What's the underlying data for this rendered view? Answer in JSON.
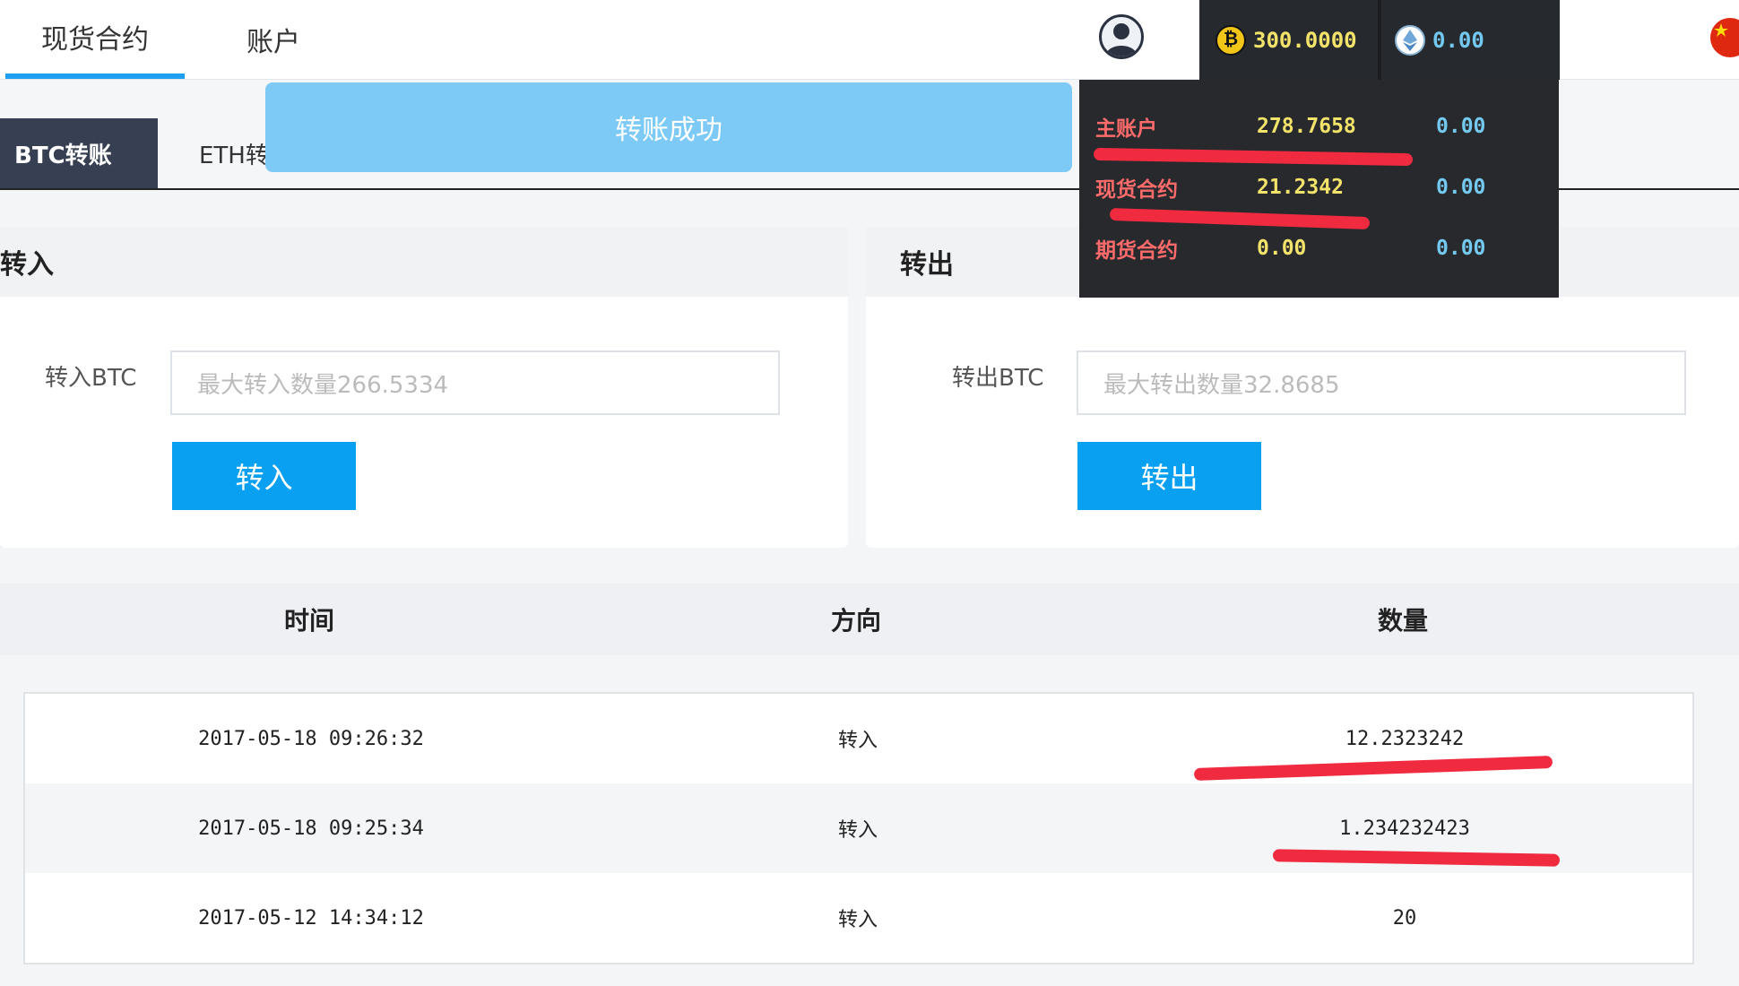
{
  "topnav": {
    "tabs": [
      "现货合约",
      "账户"
    ]
  },
  "balances": {
    "btc": "300.0000",
    "eth": "0.00"
  },
  "subtabs": {
    "btc": "BTC转账",
    "eth": "ETH转账"
  },
  "toast": "转账成功",
  "dropdown": {
    "rows": [
      {
        "label": "主账户",
        "btc": "278.7658",
        "eth": "0.00"
      },
      {
        "label": "现货合约",
        "btc": "21.2342",
        "eth": "0.00"
      },
      {
        "label": "期货合约",
        "btc": "0.00",
        "eth": "0.00"
      }
    ]
  },
  "transfer_in": {
    "title": "转入",
    "label": "转入BTC",
    "placeholder": "最大转入数量266.5334",
    "button": "转入"
  },
  "transfer_out": {
    "title": "转出",
    "label": "转出BTC",
    "placeholder": "最大转出数量32.8685",
    "button": "转出"
  },
  "table": {
    "headers": [
      "时间",
      "方向",
      "数量"
    ],
    "rows": [
      {
        "time": "2017-05-18 09:26:32",
        "direction": "转入",
        "amount": "12.2323242"
      },
      {
        "time": "2017-05-18 09:25:34",
        "direction": "转入",
        "amount": "1.234232423"
      },
      {
        "time": "2017-05-12 14:34:12",
        "direction": "转入",
        "amount": "20"
      }
    ]
  },
  "colors": {
    "accent": "#0aa0f1",
    "nav_active": "#1e9ff2",
    "dark_panel": "#27292d",
    "annotation_red": "#f02a3f"
  }
}
